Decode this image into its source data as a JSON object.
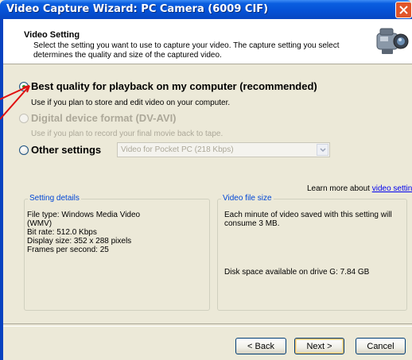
{
  "window": {
    "title": "Video Capture Wizard: PC Camera (6009 CIF)"
  },
  "header": {
    "title": "Video Setting",
    "description": "Select the setting you want to use to capture your video. The capture setting you select determines the quality and size of the captured video."
  },
  "options": [
    {
      "label": "Best quality for playback on my computer (recommended)",
      "description": "Use if you plan to store and edit video on your computer.",
      "selected": true,
      "enabled": true
    },
    {
      "label": "Digital device format (DV-AVI)",
      "description": "Use if you plan to record your final movie back to tape.",
      "selected": false,
      "enabled": false
    },
    {
      "label": "Other settings",
      "selected": false,
      "enabled": true
    }
  ],
  "other_settings_select": {
    "value": "Video for Pocket PC (218 Kbps)"
  },
  "learn_more": {
    "text": "Learn more about ",
    "link": "video settings."
  },
  "setting_details": {
    "title": "Setting details",
    "lines": [
      "File type: Windows Media Video",
      "(WMV)",
      "Bit rate: 512.0 Kbps",
      "Display size: 352 x 288 pixels",
      "Frames per second: 25"
    ]
  },
  "video_file_size": {
    "title": "Video file size",
    "summary": "Each minute of video saved with this setting will consume 3 MB.",
    "disk_space": "Disk space available on drive G: 7.84 GB"
  },
  "buttons": {
    "back": "< Back",
    "next": "Next >",
    "cancel": "Cancel"
  },
  "colors": {
    "title_bar": "#0552d6",
    "annotation_arrow": "#e01010",
    "group_title": "#0046d5",
    "link": "#0000ee"
  },
  "icons": [
    "close-icon",
    "camcorder-icon",
    "dropdown-arrow-icon"
  ]
}
